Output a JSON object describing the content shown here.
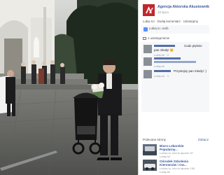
{
  "photo": {
    "description_icon": "wedding-photo"
  },
  "post": {
    "page_name": "Agencja Aktorska Akustownik",
    "time": "10 lipca",
    "actions": [
      "Lubię to!",
      "Dodaj komentarz",
      "Udostępnij"
    ],
    "likes_text": "Lubią to: osób",
    "shares_text": "1 udostępnienie"
  },
  "comments": [
    {
      "text": "Cudo pięknie",
      "extra": "pan młody! 😊",
      "meta": "Lubię to! · 2"
    },
    {
      "text": "",
      "meta": "Lubię to!"
    },
    {
      "text": "Przystojny pan młody! :)",
      "extra": "",
      "meta": "Lubię to! · 1"
    }
  ],
  "recommend": {
    "title": "Polecane strony",
    "link": "Zobacz",
    "items": [
      {
        "name": "Biuro Lekarskie",
        "name2": "Popularny...",
        "meta": "Lubisz to, lubi to łącznie 57",
        "meta2": "Lubię to!"
      },
      {
        "name": "Ośrodek Szkolenia",
        "name2": "Kierowców i Cw...",
        "meta": "Lubisz to, lubi to łącznie 150",
        "meta2": "Lubię to!"
      }
    ]
  },
  "colors": {
    "brand": "#c0272d",
    "link": "#365899",
    "fb_blue": "#3b5998"
  }
}
